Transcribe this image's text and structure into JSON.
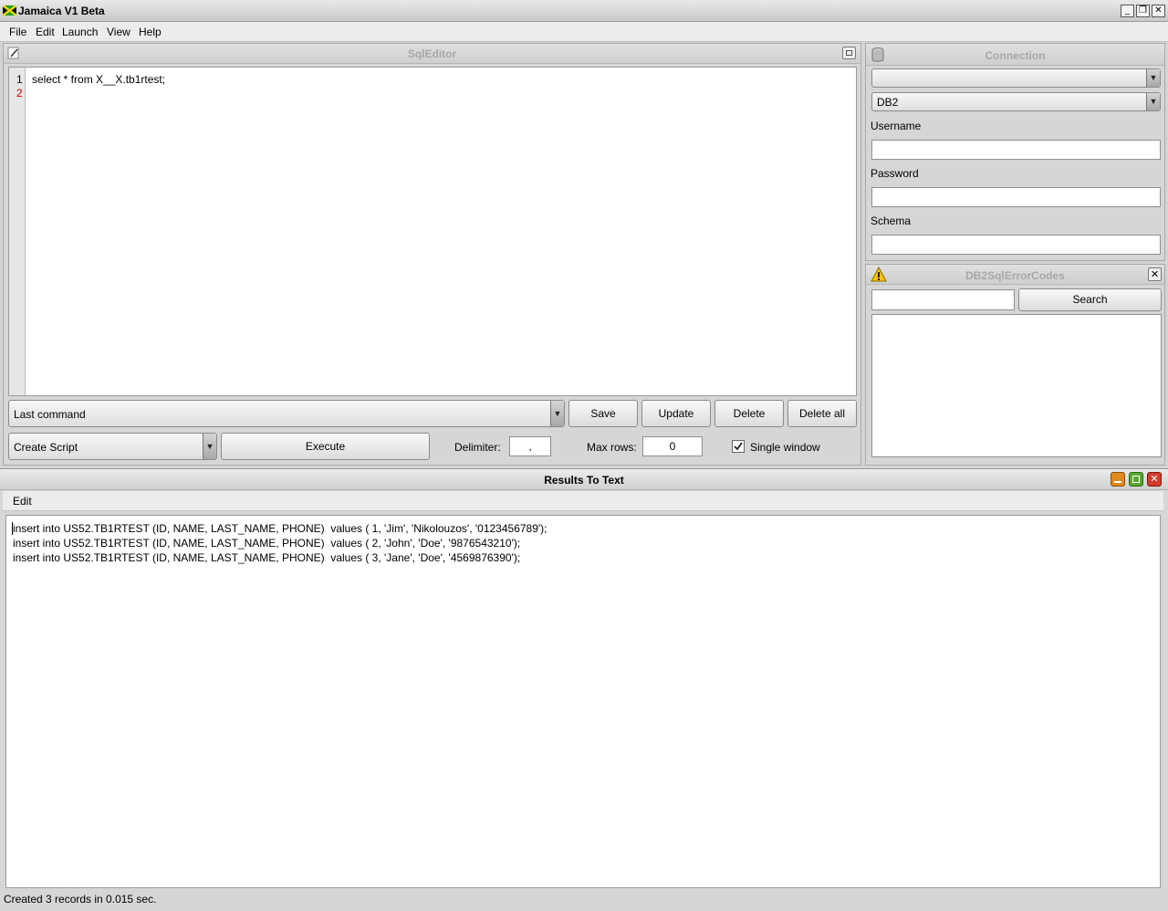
{
  "window": {
    "title": "Jamaica V1 Beta",
    "controls": {
      "minimize": "_",
      "restore": "❐",
      "close": "✕"
    }
  },
  "menu": [
    "File",
    "Edit",
    "Launch",
    "View",
    "Help"
  ],
  "sql_editor": {
    "title": "SqlEditor",
    "line_numbers": [
      "1",
      "2"
    ],
    "code_lines": [
      "select * from X__X.tb1rtest;"
    ],
    "history_combo": "Last command",
    "buttons": {
      "save": "Save",
      "update": "Update",
      "delete": "Delete",
      "delete_all": "Delete all",
      "execute": "Execute"
    },
    "script_combo": "Create Script",
    "delimiter_label": "Delimiter:",
    "delimiter_value": ",",
    "max_rows_label": "Max rows:",
    "max_rows_value": "0",
    "single_window_label": "Single window",
    "single_window_checked": true
  },
  "connection": {
    "title": "Connection",
    "profile_value": "",
    "db_type": "DB2",
    "username_label": "Username",
    "username_value": "",
    "password_label": "Password",
    "password_value": "",
    "schema_label": "Schema",
    "schema_value": ""
  },
  "error_codes": {
    "title": "DB2SqlErrorCodes",
    "search_value": "",
    "search_button": "Search"
  },
  "results": {
    "title": "Results To Text",
    "menu": "Edit",
    "lines": [
      "insert into US52.TB1RTEST (ID, NAME, LAST_NAME, PHONE)  values ( 1, 'Jim', 'Nikolouzos', '0123456789');",
      "insert into US52.TB1RTEST (ID, NAME, LAST_NAME, PHONE)  values ( 2, 'John', 'Doe', '9876543210');",
      "insert into US52.TB1RTEST (ID, NAME, LAST_NAME, PHONE)  values ( 3, 'Jane', 'Doe', '4569876390');"
    ],
    "status": "Created 3 records in 0.015 sec."
  },
  "colors": {
    "line_number_active": "#cc0000",
    "warning": "#f5c400",
    "minimize": "#e08a1e",
    "maximize": "#5aa832",
    "close": "#d33a2c"
  }
}
